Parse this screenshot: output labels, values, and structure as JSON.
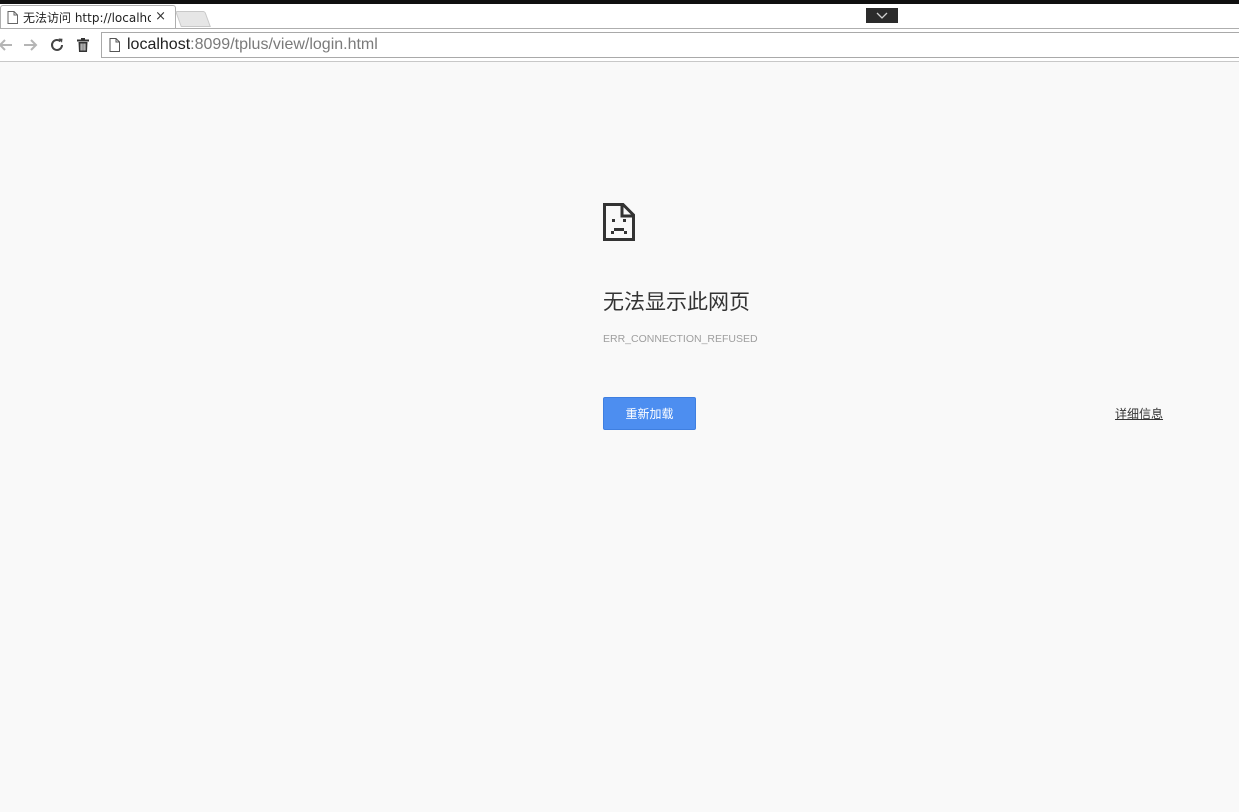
{
  "tab": {
    "title": "无法访问 http://localhos",
    "close_label": "×",
    "page_icon": "page-icon"
  },
  "toolbar": {
    "back_icon": "arrow-left-icon",
    "forward_icon": "arrow-right-icon",
    "reload_icon": "reload-icon",
    "trash_icon": "trash-icon"
  },
  "omnibox": {
    "url_host": "localhost",
    "url_rest": ":8099/tplus/view/login.html"
  },
  "error_page": {
    "icon": "sad-page-icon",
    "title": "无法显示此网页",
    "error_code": "ERR_CONNECTION_REFUSED",
    "reload_button_label": "重新加载",
    "details_link_label": "详细信息"
  },
  "colors": {
    "accent_button": "#4d8ef0",
    "page_background": "#f9f9f9",
    "top_bar": "#101010"
  }
}
